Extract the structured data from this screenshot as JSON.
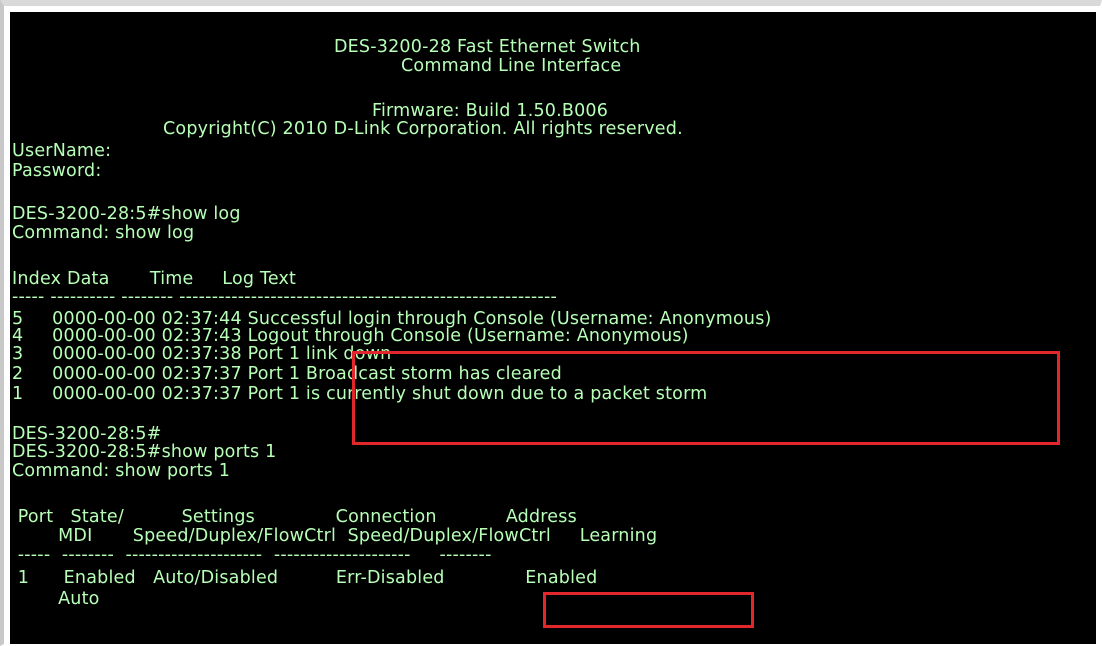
{
  "terminal": {
    "banner": {
      "title_line1": "DES-3200-28 Fast Ethernet Switch",
      "title_line2": "Command Line Interface",
      "firmware": "Firmware: Build 1.50.B006",
      "copyright": "Copyright(C) 2010 D-Link Corporation. All rights reserved."
    },
    "login": {
      "username_prompt": "UserName:",
      "password_prompt": "Password:"
    },
    "show_log": {
      "prompt": "DES-3200-28:5#show log",
      "echo": "Command: show log",
      "header": "Index Data       Time     Log Text",
      "separator": "----- ---------- -------- ----------------------------------------------------------",
      "rows": [
        {
          "line": "5     0000-00-00 02:37:44 Successful login through Console (Username: Anonymous)"
        },
        {
          "line": "4     0000-00-00 02:37:43 Logout through Console (Username: Anonymous)"
        },
        {
          "line": "3     0000-00-00 02:37:38 Port 1 link down"
        },
        {
          "line": "2     0000-00-00 02:37:37 Port 1 Broadcast storm has cleared"
        },
        {
          "line": "1     0000-00-00 02:37:37 Port 1 is currently shut down due to a packet storm"
        }
      ]
    },
    "show_ports": {
      "prompt_empty": "DES-3200-28:5#",
      "prompt": "DES-3200-28:5#show ports 1",
      "echo": "Command: show ports 1",
      "header1": " Port   State/          Settings              Connection            Address",
      "header2": "        MDI       Speed/Duplex/FlowCtrl  Speed/Duplex/FlowCtrl     Learning",
      "separator": " -----  --------  ---------------------  ---------------------     --------",
      "row1": " 1      Enabled   Auto/Disabled          Err-Disabled              Enabled",
      "row2": "        Auto"
    }
  },
  "colors": {
    "terminal_bg": "#000000",
    "terminal_text": "#b7ffb7",
    "highlight_box": "#e3262c"
  }
}
